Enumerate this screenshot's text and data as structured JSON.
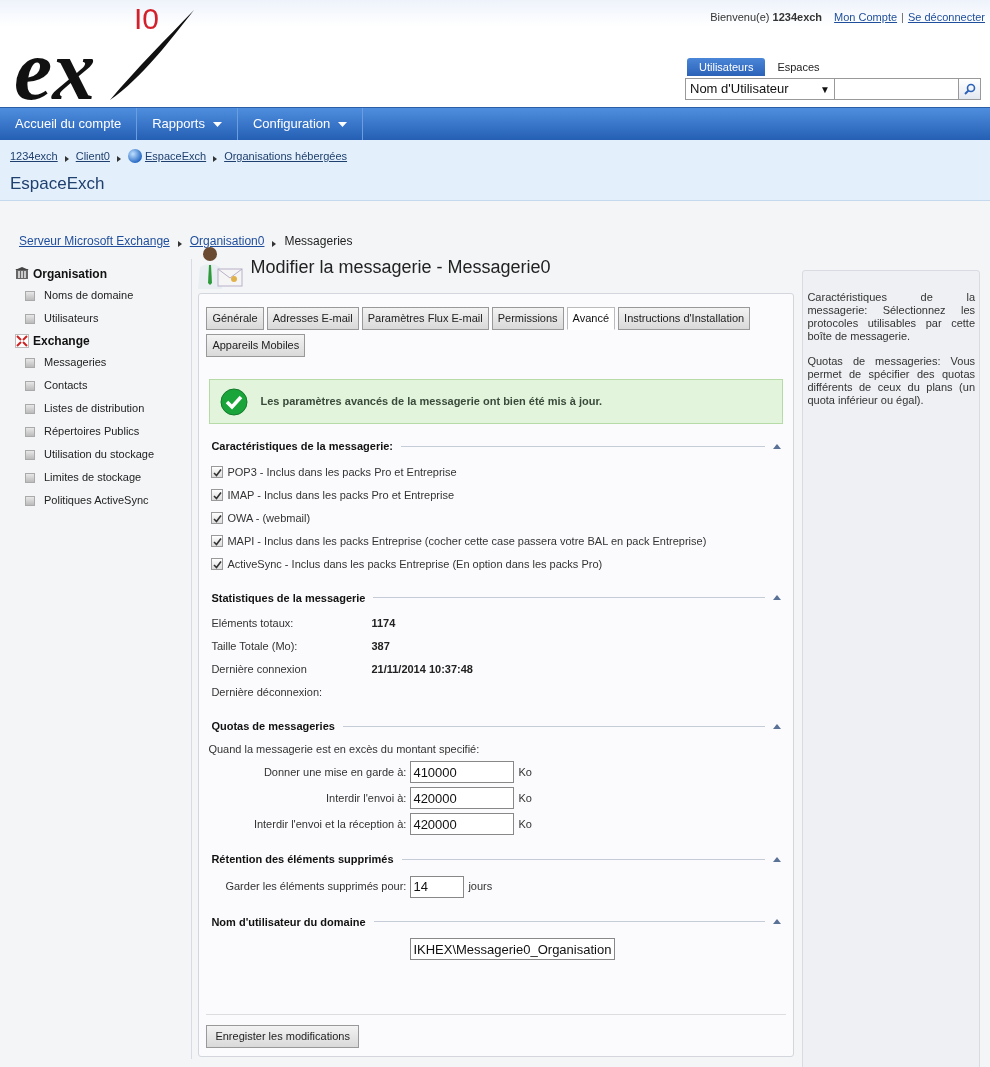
{
  "logo": {
    "text": "ex",
    "mark": "I0"
  },
  "user_bar": {
    "welcome": "Bienvenu(e) **1234exch**",
    "links": [
      "Mon Compte",
      "Se déconnecter"
    ],
    "separator": "|"
  },
  "search": {
    "tabs": [
      {
        "label": "Utilisateurs",
        "selected": true
      },
      {
        "label": "Espaces",
        "selected": false
      }
    ],
    "select": "Nom d'Utilisateur",
    "caret": "▼"
  },
  "nav": [
    {
      "label": "Accueil du compte",
      "dropdown": false
    },
    {
      "label": "Rapports",
      "dropdown": true
    },
    {
      "label": "Configuration",
      "dropdown": true
    }
  ],
  "breadcrumb": [
    {
      "label": "1234exch",
      "globe": false
    },
    {
      "label": "Client0",
      "globe": false
    },
    {
      "label": "EspaceExch",
      "globe": true
    },
    {
      "label": "Organisations hébergées",
      "globe": false
    }
  ],
  "space_title": "EspaceExch",
  "sub_breadcrumb": [
    {
      "label": "Serveur Microsoft Exchange",
      "link": true
    },
    {
      "label": "Organisation0",
      "link": true
    },
    {
      "label": "Messageries",
      "link": false
    }
  ],
  "sidebar": [
    {
      "label": "Organisation",
      "kind": "organisation",
      "children": [
        {
          "label": "Noms de domaine"
        },
        {
          "label": "Utilisateurs"
        }
      ]
    },
    {
      "label": "Exchange",
      "kind": "exchange",
      "children": [
        {
          "label": "Messageries"
        },
        {
          "label": "Contacts"
        },
        {
          "label": "Listes de distribution"
        },
        {
          "label": "Répertoires Publics"
        },
        {
          "label": "Utilisation du stockage"
        },
        {
          "label": "Limites de stockage"
        },
        {
          "label": "Politiques ActiveSync"
        }
      ]
    }
  ],
  "page_title": "Modifier la messagerie - Messagerie0",
  "tabs": [
    {
      "label": "Générale",
      "selected": false
    },
    {
      "label": "Adresses E-mail",
      "selected": false
    },
    {
      "label": "Paramètres Flux E-mail",
      "selected": false
    },
    {
      "label": "Permissions",
      "selected": false
    },
    {
      "label": "Avancé",
      "selected": true
    },
    {
      "label": "Instructions d'Installation",
      "selected": false
    },
    {
      "label": "Appareils Mobiles",
      "selected": false
    }
  ],
  "success_message": "Les paramètres avancés de la messagerie ont bien été mis à jour.",
  "sections": [
    {
      "kind": "checkboxes",
      "title": "Caractéristiques de la messagerie:",
      "items": [
        {
          "label": "POP3 - Inclus dans les packs Pro et Entreprise",
          "checked": true
        },
        {
          "label": "IMAP - Inclus dans les packs Pro et Entreprise",
          "checked": true
        },
        {
          "label": "OWA - (webmail)",
          "checked": true
        },
        {
          "label": "MAPI - Inclus dans les packs Entreprise (cocher cette case passera votre BAL en pack Entreprise)",
          "checked": true
        },
        {
          "label": "ActiveSync - Inclus dans les packs Entreprise (En option dans les packs Pro)",
          "checked": true
        }
      ]
    },
    {
      "kind": "stats",
      "title": "Statistiques de la messagerie",
      "items": [
        {
          "label": "Eléments totaux:",
          "value": "1174"
        },
        {
          "label": "Taille Totale (Mo):",
          "value": "387"
        },
        {
          "label": "Dernière connexion",
          "value": "21/11/2014 10:37:48"
        },
        {
          "label": "Dernière déconnexion:"
        }
      ]
    },
    {
      "kind": "fields",
      "title": "Quotas de messageries",
      "intro": "Quand la messagerie est en excès du montant specifié:",
      "items": [
        {
          "label": "Donner une mise en garde à:",
          "value": "410000",
          "unit": "Ko"
        },
        {
          "label": "Interdir l'envoi à:",
          "value": "420000",
          "unit": "Ko"
        },
        {
          "label": "Interdir l'envoi et la réception à:",
          "value": "420000",
          "unit": "Ko"
        }
      ]
    },
    {
      "kind": "retention",
      "title": "Rétention des éléments supprimés",
      "items": [
        {
          "label": "Garder les éléments supprimés pour:",
          "value": "14",
          "unit": "jours"
        }
      ]
    },
    {
      "kind": "domain",
      "title": "Nom d'utilisateur du domaine",
      "value": "IKHEX\\Messagerie0_Organisation"
    }
  ],
  "save_button": "Enregister les modifications",
  "help": [
    "Caractéristiques de la messagerie: Sélectionnez les protocoles utilisables par cette boîte de messagerie.",
    "Quotas de messageries: Vous permet de spécifier des quotas différents de ceux du plans (un quota inférieur ou égal)."
  ]
}
